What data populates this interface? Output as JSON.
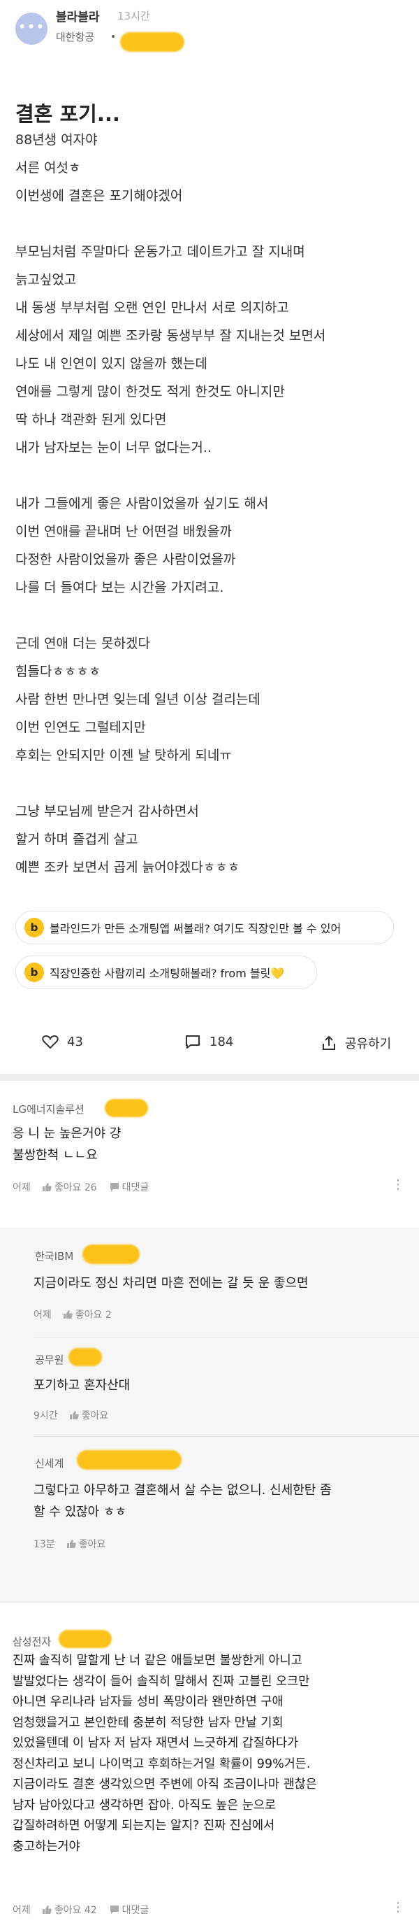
{
  "post": {
    "author": "블라블라",
    "time": "13시간",
    "company": "대한항공",
    "title": "결혼 포기...",
    "body": [
      "88년생 여자야",
      "서른 여섯ㅎ",
      "이번생에 결혼은 포기해야겠어",
      "",
      "부모님처럼 주말마다 운동가고 데이트가고 잘 지내며",
      "늙고싶었고",
      "내 동생 부부처럼 오랜 연인 만나서 서로 의지하고",
      "세상에서 제일 예쁜 조카랑 동생부부 잘 지내는것 보면서",
      "나도 내 인연이 있지 않을까 했는데",
      "연애를 그렇게 많이 한것도 적게 한것도 아니지만",
      "딱 하나 객관화 된게 있다면",
      "내가 남자보는 눈이 너무 없다는거..",
      "",
      "내가 그들에게 좋은 사람이었을까 싶기도 해서",
      "이번 연애를 끝내며 난 어떤걸 배웠을까",
      "다정한 사람이었을까 좋은 사람이었을까",
      "나를 더 들여다 보는 시간을 가지려고.",
      "",
      "근데 연애 더는 못하겠다",
      "힘들다ㅎㅎㅎㅎ",
      "사람 한번 만나면 잊는데 일년 이상 걸리는데",
      "이번 인연도 그럴테지만",
      "후회는 안되지만 이젠 날 탓하게 되네ㅠ",
      "",
      "그냥 부모님께 받은거 감사하면서",
      "할거 하며 즐겁게 살고",
      "예쁜 조카 보면서 곱게 늙어야겠다ㅎㅎㅎ"
    ],
    "banner1": "블라인드가 만든 소개팅앱 써볼래? 여기도 직장인만 볼 수 있어",
    "banner2": "직장인증한 사람끼리 소개팅해볼래? from 블릿💛",
    "banner_icon": "b",
    "likes": "43",
    "comments": "184",
    "share": "공유하기"
  },
  "comments": [
    {
      "company": "LG에너지솔루션",
      "text": [
        "응 니 눈 높은거야 걍",
        "불쌍한척 ㄴㄴ요"
      ],
      "time": "어제",
      "likes": "좋아요 26",
      "reply": "대댓글"
    },
    {
      "company": "한국IBM",
      "text": [
        "지금이라도 정신 차리면 마흔 전에는 갈 듯 운 좋으면"
      ],
      "time": "어제",
      "likes": "좋아요 2"
    },
    {
      "company": "공무원",
      "text": [
        "포기하고 혼자산대"
      ],
      "time": "9시간",
      "likes": "좋아요"
    },
    {
      "company": "신세계",
      "text": [
        "그렇다고 아무하고 결혼해서 살 수는 없으니. 신세한탄 좀",
        "할 수 있잖아 ㅎㅎ"
      ],
      "time": "13분",
      "likes": "좋아요"
    },
    {
      "company": "삼성전자",
      "text": [
        "진짜 솔직히 말할게 난 너 같은 애들보면 불쌍한게 아니고",
        "발발었다는 생각이 들어 솔직히 말해서 진짜 고블린 오크만",
        "아니면 우리나라 남자들 성비 폭망이라 왠만하면 구애",
        "엄청했을거고 본인한테 충분히 적당한 남자 만날 기회",
        "있었을텐데 이 남자 저 남자 재면서 느긋하게 갑질하다가",
        "정신차리고 보니 나이먹고 후회하는거일 확률이 99%거든.",
        "지금이라도 결혼 생각있으면 주변에 아직 조금이나마 괜찮은",
        "남자 남아있다고 생각하면 잡아. 아직도 높은 눈으로",
        "갑질하려하면 어떻게 되는지는 알지? 진짜 진심에서",
        "충고하는거야"
      ],
      "time": "어제",
      "likes": "좋아요 42",
      "reply": "대댓글"
    }
  ],
  "colors": {
    "accent": "#fcc21a",
    "avatar": "#b9c6ec"
  },
  "icons": [
    "heart-icon",
    "comment-icon",
    "share-icon",
    "thumb-up-icon",
    "comment-small-icon",
    "more-icon"
  ]
}
